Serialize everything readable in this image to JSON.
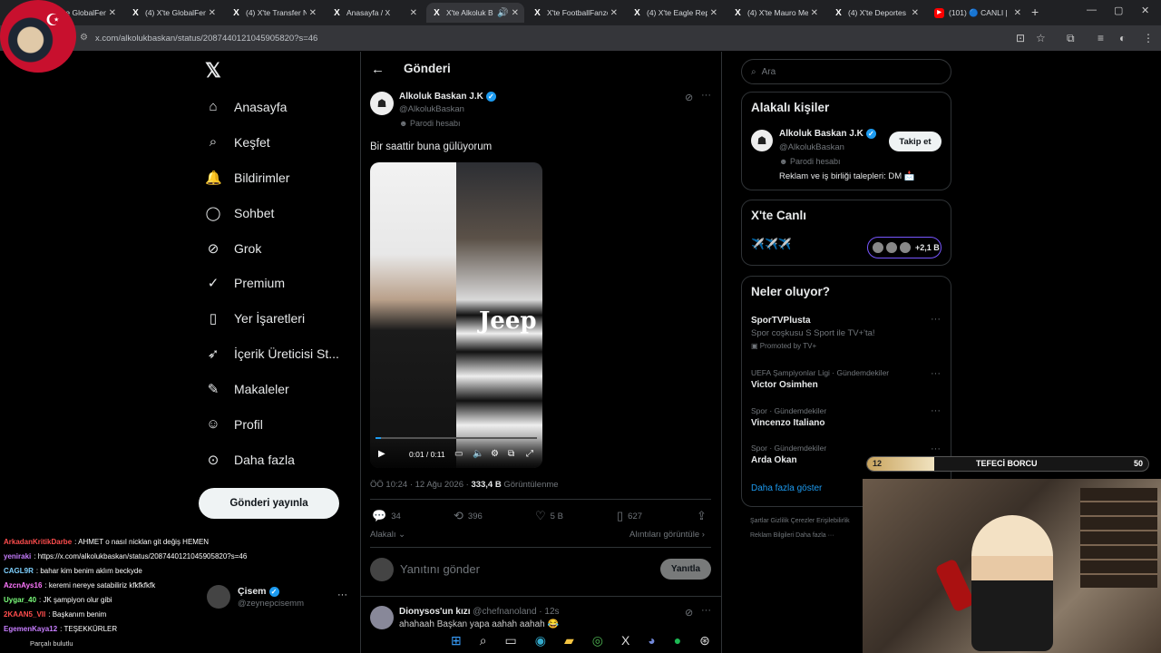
{
  "browser": {
    "tabs": [
      {
        "title": "(4) X'te GlobalFen",
        "icon": "x-icon",
        "active": false
      },
      {
        "title": "(4) X'te Transfer N",
        "icon": "x-icon",
        "active": false
      },
      {
        "title": "Anasayfa / X",
        "icon": "x-icon",
        "active": false
      },
      {
        "title": "X'te Alkoluk B",
        "icon": "x-icon",
        "active": true
      },
      {
        "title": "X'te FootballFanzo",
        "icon": "x-icon",
        "active": false
      },
      {
        "title": "(4) X'te Eagle Repo",
        "icon": "x-icon",
        "active": false
      },
      {
        "title": "(4) X'te Mauro Me",
        "icon": "x-icon",
        "active": false
      },
      {
        "title": "(4) X'te Deportes",
        "icon": "x-icon",
        "active": false
      },
      {
        "title": "(101) 🔵 CANLI |",
        "icon": "youtube-icon",
        "active": false
      }
    ],
    "url": "x.com/alkolukbaskan/status/2087440121045905820?s=46"
  },
  "sidebar": {
    "items": [
      {
        "label": "Anasayfa",
        "icon": "home-icon",
        "glyph": "⌂"
      },
      {
        "label": "Keşfet",
        "icon": "search-icon",
        "glyph": "⌕"
      },
      {
        "label": "Bildirimler",
        "icon": "bell-icon",
        "glyph": "🔔"
      },
      {
        "label": "Sohbet",
        "icon": "chat-icon",
        "glyph": "◯"
      },
      {
        "label": "Grok",
        "icon": "grok-icon",
        "glyph": "⊘"
      },
      {
        "label": "Premium",
        "icon": "premium-icon",
        "glyph": "✓"
      },
      {
        "label": "Yer İşaretleri",
        "icon": "bookmark-icon",
        "glyph": "▯"
      },
      {
        "label": "İçerik Üreticisi St...",
        "icon": "rocket-icon",
        "glyph": "➶"
      },
      {
        "label": "Makaleler",
        "icon": "article-icon",
        "glyph": "✎"
      },
      {
        "label": "Profil",
        "icon": "profile-icon",
        "glyph": "☺"
      },
      {
        "label": "Daha fazla",
        "icon": "more-circle-icon",
        "glyph": "⊙"
      }
    ],
    "post_button": "Gönderi yayınla",
    "account": {
      "name": "Çisem",
      "handle": "@zeynepcisemm"
    }
  },
  "post": {
    "header_title": "Gönderi",
    "author_name": "Alkoluk Baskan J.K",
    "author_handle": "@AlkolukBaskan",
    "parody_label": "Parodi hesabı",
    "text": "Bir saattir buna gülüyorum",
    "video_time": "0:01 / 0:11",
    "video_overlay_text": "Jeep",
    "video_progress": 0.03,
    "timestamp": "ÖÖ 10:24 · 12 Ağu 2026 · ",
    "views_count": "333,4 B",
    "views_label": "Görüntülenme",
    "replies": "34",
    "reposts": "396",
    "likes": "5 B",
    "bookmarks": "627",
    "related_label": "Alakalı",
    "quotes_label": "Alıntıları görüntüle",
    "reply_placeholder": "Yanıtını gönder",
    "reply_button": "Yanıtla",
    "next_reply_name": "Dionysos'un kızı",
    "next_reply_handle": "@chefnanoland · 12s",
    "next_reply_text": "ahahaah Başkan yapa aahah aahah 😂"
  },
  "right": {
    "search_placeholder": "Ara",
    "relevant_title": "Alakalı kişiler",
    "relevant_name": "Alkoluk Baskan J.K",
    "relevant_handle": "@AlkolukBaskan",
    "relevant_parody": "Parodi hesabı",
    "relevant_bio": "Reklam ve iş birliği talepleri: DM 📩",
    "follow_button": "Takip et",
    "live_title": "X'te Canlı",
    "live_text": "✈️✈️✈️",
    "live_count": "+2,1 B",
    "trends_title": "Neler oluyor?",
    "trends": [
      {
        "meta": "",
        "name": "SporTVPlusta",
        "desc": "Spor coşkusu S Sport ile TV+'ta!",
        "promoted": "Promoted by TV+"
      },
      {
        "meta": "UEFA Şampiyonlar Ligi · Gündemdekiler",
        "name": "Victor Osimhen"
      },
      {
        "meta": "Spor · Gündemdekiler",
        "name": "Vincenzo Italiano"
      },
      {
        "meta": "Spor · Gündemdekiler",
        "name": "Arda Okan"
      }
    ],
    "show_more": "Daha fazla göster",
    "footer_1": "Şartlar   Gizlilik   Çerezler   Erişilebilirlik",
    "footer_2": "Reklam Bilgileri   Daha fazla ···"
  },
  "overlay": {
    "bar_left": "12",
    "bar_title": "TEFECİ BORCU",
    "bar_right": "50",
    "progress": 0.24
  },
  "chat": [
    {
      "user": "ArkadanKritikDarbe",
      "msg": ": AHMET o nasıl nicklan git değiş HEMEN",
      "color": "#ff4d4d"
    },
    {
      "user": "yeniraki",
      "msg": ": https://x.com/alkolukbaskan/status/2087440121045905820?s=46",
      "color": "#c77dff"
    },
    {
      "user": "CAGL9R",
      "msg": ": bahar kim benim aklım beckyde",
      "color": "#7fd1ff"
    },
    {
      "user": "AzcnAys16",
      "msg": ": keremi nereye satabiliriz kfkfkfkfk",
      "color": "#ff77ff"
    },
    {
      "user": "Uygar_40",
      "msg": ": JK şampiyon olur gibi",
      "color": "#7cff7c"
    },
    {
      "user": "2KAAN5_VII",
      "msg": ": Başkanım benim",
      "color": "#ff4d4d"
    },
    {
      "user": "EgemenKaya12",
      "msg": ": TEŞEKKÜRLER",
      "color": "#c77dff"
    }
  ],
  "chat_bottom": "Parçalı bulutlu",
  "colors": {
    "accent": "#1d9bf0",
    "border": "#2f3336",
    "muted": "#71767b"
  }
}
